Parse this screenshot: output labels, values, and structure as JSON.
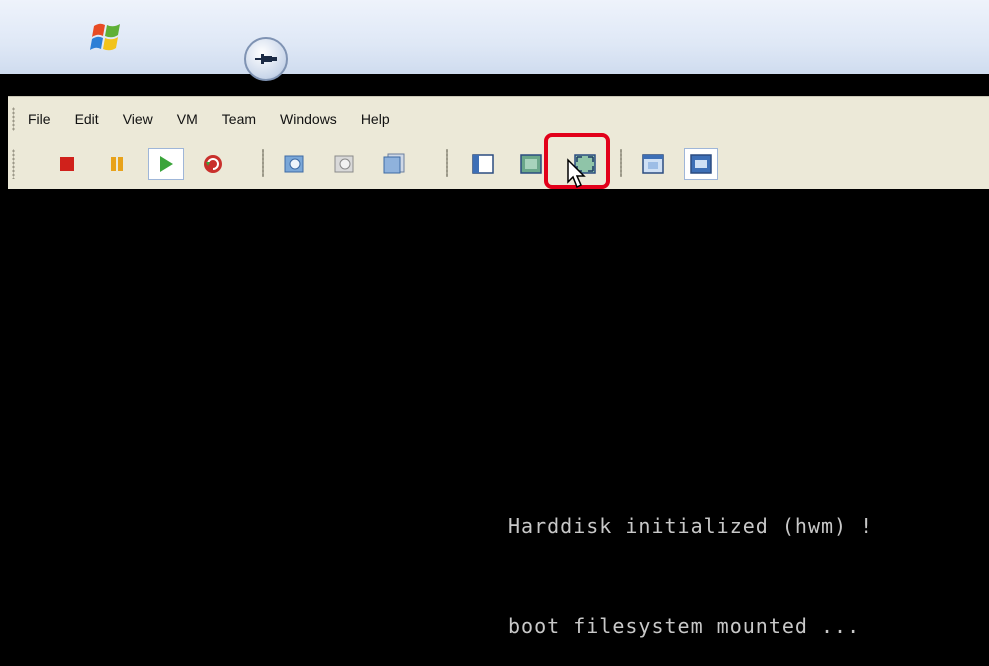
{
  "menubar": {
    "items": [
      "File",
      "Edit",
      "View",
      "VM",
      "Team",
      "Windows",
      "Help"
    ]
  },
  "toolbar": {
    "buttons": [
      {
        "name": "power-off",
        "icon": "stop-square-icon",
        "color": "#d0211b"
      },
      {
        "name": "suspend",
        "icon": "pause-icon",
        "color": "#e8a21a"
      },
      {
        "name": "power-on",
        "icon": "play-triangle-icon",
        "color": "#3aa43a"
      },
      {
        "name": "reset",
        "icon": "reset-cycle-icon",
        "color": "#c9302c"
      },
      {
        "name": "snapshot-take",
        "icon": "snapshot-icon"
      },
      {
        "name": "snapshot-revert",
        "icon": "snapshot-revert-icon"
      },
      {
        "name": "snapshot-manager",
        "icon": "snapshot-manager-icon"
      },
      {
        "name": "show-sidebar",
        "icon": "sidebar-panel-icon"
      },
      {
        "name": "quick-switch",
        "icon": "quick-switch-icon"
      },
      {
        "name": "full-screen",
        "icon": "full-screen-icon"
      },
      {
        "name": "summary-view",
        "icon": "summary-view-icon"
      },
      {
        "name": "console-view",
        "icon": "console-view-icon"
      }
    ]
  },
  "console": {
    "line1": "Harddisk initialized (hwm) !",
    "line2": "boot filesystem mounted ..."
  },
  "colors": {
    "highlight": "#e2001a",
    "console_bg": "#000000",
    "console_text": "#c8c8c8"
  }
}
